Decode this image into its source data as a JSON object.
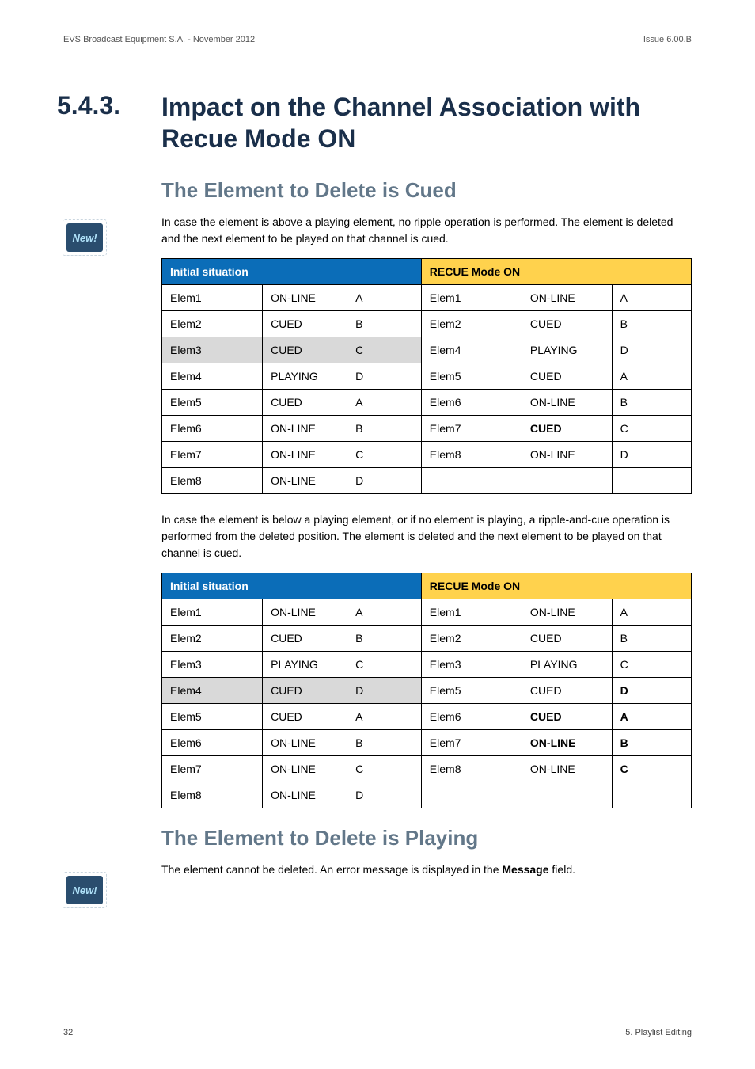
{
  "header": {
    "left": "EVS Broadcast Equipment S.A. - November 2012",
    "right": "Issue 6.00.B"
  },
  "section": {
    "number": "5.4.3.",
    "title": "Impact on the Channel Association with Recue Mode ON"
  },
  "subA": {
    "heading": "The Element to Delete is Cued",
    "intro": "In case the element is above a playing element, no ripple operation is performed. The element is deleted and the next element to be played on that channel is cued.",
    "table1": {
      "left_header": "Initial situation",
      "right_header": "RECUE Mode ON",
      "rows": [
        {
          "l": [
            "Elem1",
            "ON-LINE",
            "A"
          ],
          "r": [
            "Elem1",
            "ON-LINE",
            "A"
          ],
          "lhi": false,
          "rbold": [
            false,
            false,
            false
          ]
        },
        {
          "l": [
            "Elem2",
            "CUED",
            "B"
          ],
          "r": [
            "Elem2",
            "CUED",
            "B"
          ],
          "lhi": false,
          "rbold": [
            false,
            false,
            false
          ]
        },
        {
          "l": [
            "Elem3",
            "CUED",
            "C"
          ],
          "r": [
            "Elem4",
            "PLAYING",
            "D"
          ],
          "lhi": true,
          "rbold": [
            false,
            false,
            false
          ]
        },
        {
          "l": [
            "Elem4",
            "PLAYING",
            "D"
          ],
          "r": [
            "Elem5",
            "CUED",
            "A"
          ],
          "lhi": false,
          "rbold": [
            false,
            false,
            false
          ]
        },
        {
          "l": [
            "Elem5",
            "CUED",
            "A"
          ],
          "r": [
            "Elem6",
            "ON-LINE",
            "B"
          ],
          "lhi": false,
          "rbold": [
            false,
            false,
            false
          ]
        },
        {
          "l": [
            "Elem6",
            "ON-LINE",
            "B"
          ],
          "r": [
            "Elem7",
            "CUED",
            "C"
          ],
          "lhi": false,
          "rbold": [
            false,
            true,
            false
          ]
        },
        {
          "l": [
            "Elem7",
            "ON-LINE",
            "C"
          ],
          "r": [
            "Elem8",
            "ON-LINE",
            "D"
          ],
          "lhi": false,
          "rbold": [
            false,
            false,
            false
          ]
        },
        {
          "l": [
            "Elem8",
            "ON-LINE",
            "D"
          ],
          "r": [
            "",
            "",
            ""
          ],
          "lhi": false,
          "rbold": [
            false,
            false,
            false
          ]
        }
      ]
    },
    "middle": "In case the element is below a playing element, or if no element is playing, a ripple-and-cue operation is performed from the deleted position. The element is deleted and the next element to be played on that channel is cued.",
    "table2": {
      "left_header": "Initial situation",
      "right_header": "RECUE Mode ON",
      "rows": [
        {
          "l": [
            "Elem1",
            "ON-LINE",
            "A"
          ],
          "r": [
            "Elem1",
            "ON-LINE",
            "A"
          ],
          "lhi": false,
          "rbold": [
            false,
            false,
            false
          ]
        },
        {
          "l": [
            "Elem2",
            "CUED",
            "B"
          ],
          "r": [
            "Elem2",
            "CUED",
            "B"
          ],
          "lhi": false,
          "rbold": [
            false,
            false,
            false
          ]
        },
        {
          "l": [
            "Elem3",
            "PLAYING",
            "C"
          ],
          "r": [
            "Elem3",
            "PLAYING",
            "C"
          ],
          "lhi": false,
          "rbold": [
            false,
            false,
            false
          ]
        },
        {
          "l": [
            "Elem4",
            "CUED",
            "D"
          ],
          "r": [
            "Elem5",
            "CUED",
            "D"
          ],
          "lhi": true,
          "rbold": [
            false,
            false,
            true
          ]
        },
        {
          "l": [
            "Elem5",
            "CUED",
            "A"
          ],
          "r": [
            "Elem6",
            "CUED",
            "A"
          ],
          "lhi": false,
          "rbold": [
            false,
            true,
            true
          ]
        },
        {
          "l": [
            "Elem6",
            "ON-LINE",
            "B"
          ],
          "r": [
            "Elem7",
            "ON-LINE",
            "B"
          ],
          "lhi": false,
          "rbold": [
            false,
            true,
            true
          ]
        },
        {
          "l": [
            "Elem7",
            "ON-LINE",
            "C"
          ],
          "r": [
            "Elem8",
            "ON-LINE",
            "C"
          ],
          "lhi": false,
          "rbold": [
            false,
            false,
            true
          ]
        },
        {
          "l": [
            "Elem8",
            "ON-LINE",
            "D"
          ],
          "r": [
            "",
            "",
            ""
          ],
          "lhi": false,
          "rbold": [
            false,
            false,
            false
          ]
        }
      ]
    }
  },
  "subB": {
    "heading": "The Element to Delete is Playing",
    "text_before": "The element cannot be deleted. An error message is displayed in the ",
    "text_bold": "Message",
    "text_after": " field."
  },
  "badge": "New!",
  "footer": {
    "left": "32",
    "right": "5. Playlist Editing"
  }
}
